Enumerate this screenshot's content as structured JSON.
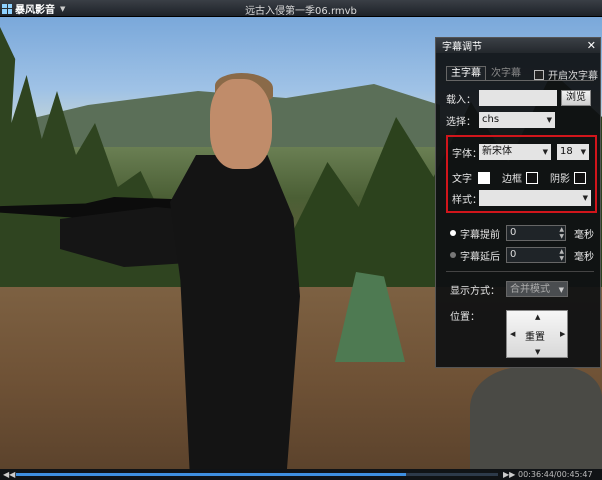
{
  "app": {
    "name": "暴风影音",
    "file_title": "远古入侵第一季06.rmvb"
  },
  "video": {
    "progress_fraction": 0.81
  },
  "playback": {
    "time": "00:36:44/00:45:47"
  },
  "dialog": {
    "title": "字幕调节",
    "tabs": [
      {
        "label": "主字幕",
        "active": true
      },
      {
        "label": "次字幕",
        "active": false
      }
    ],
    "enable_secondary_label": "开启次字幕",
    "load_label": "载入：",
    "load_value": "",
    "browse_button": "浏览",
    "select_label": "选择：",
    "select_value": "chs",
    "font_label": "字体：",
    "font_value": "新宋体",
    "size_value": "18",
    "text_color_label": "文字",
    "border_label": "边框",
    "shadow_label": "阴影",
    "style_label": "样式：",
    "style_value": "",
    "advance_label": "字幕提前",
    "advance_value": "0",
    "delay_label": "字幕延后",
    "delay_value": "0",
    "unit_label": "毫秒",
    "display_mode_label": "显示方式：",
    "display_mode_value": "合并模式",
    "position_label": "位置：",
    "reset_label": "重置"
  },
  "colors": {
    "accent": "#3f8fe0",
    "highlight_border": "#d1151b"
  }
}
